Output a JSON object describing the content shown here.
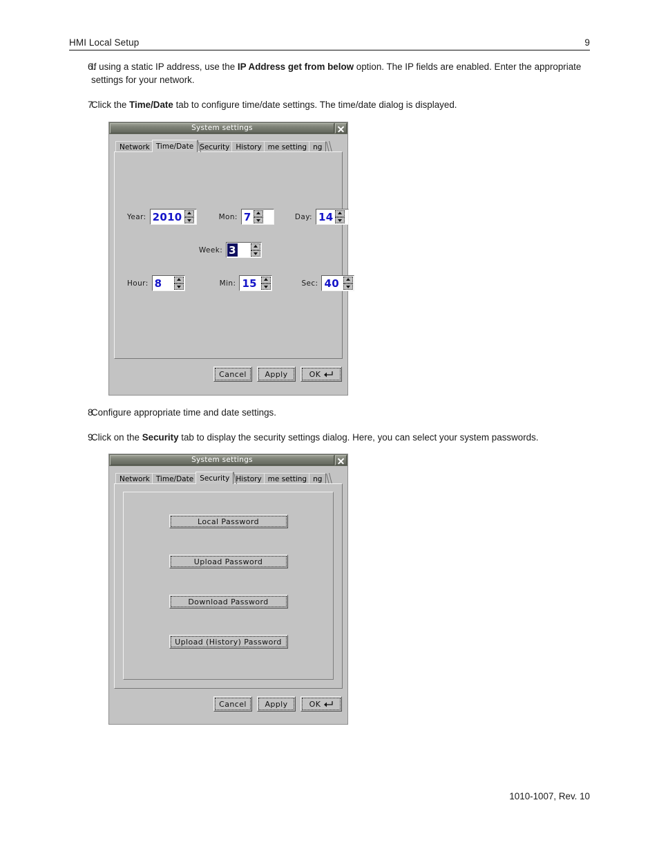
{
  "header": {
    "title": "HMI Local Setup",
    "page_number": "9"
  },
  "steps": [
    {
      "num": "6.",
      "text_before": "If using a static IP address, use the ",
      "bold": "IP Address get from below",
      "text_after": " option. The IP fields are enabled. Enter the appropriate settings for your network."
    },
    {
      "num": "7.",
      "text_before": "Click the ",
      "bold": "Time/Date",
      "text_after": " tab to configure time/date settings. The time/date dialog is displayed."
    },
    {
      "num": "8.",
      "text_before": "Configure appropriate time and date settings.",
      "bold": "",
      "text_after": ""
    },
    {
      "num": "9.",
      "text_before": "Click on the ",
      "bold": "Security",
      "text_after": " tab to display the security settings dialog. Here, you can select your system passwords."
    }
  ],
  "footer": {
    "doc_id": "1010-1007, Rev. 10"
  },
  "dialog_time_date": {
    "title": "System settings",
    "close_icon": "close-x-icon",
    "tabs": [
      {
        "label": "Network",
        "active": false
      },
      {
        "label": "Time/Date",
        "active": true
      },
      {
        "label": "Security",
        "active": false
      },
      {
        "label": "History",
        "active": false
      },
      {
        "label": "me setting",
        "active": false
      },
      {
        "label": "ng",
        "active": false
      }
    ],
    "fields": [
      {
        "label": "Year:",
        "value": "2010",
        "selected": false
      },
      {
        "label": "Mon:",
        "value": "7",
        "selected": false
      },
      {
        "label": "Day:",
        "value": "14",
        "selected": false
      },
      {
        "label": "Week:",
        "value": "3",
        "selected": true
      },
      {
        "label": "Hour:",
        "value": "8",
        "selected": false
      },
      {
        "label": "Min:",
        "value": "15",
        "selected": false
      },
      {
        "label": "Sec:",
        "value": "40",
        "selected": false
      }
    ],
    "buttons": {
      "cancel": "Cancel",
      "apply": "Apply",
      "ok": "OK"
    }
  },
  "dialog_security": {
    "title": "System settings",
    "close_icon": "close-x-icon",
    "tabs": [
      {
        "label": "Network",
        "active": false
      },
      {
        "label": "Time/Date",
        "active": false
      },
      {
        "label": "Security",
        "active": true
      },
      {
        "label": "History",
        "active": false
      },
      {
        "label": "me setting",
        "active": false
      },
      {
        "label": "ng",
        "active": false
      }
    ],
    "password_buttons": [
      "Local Password",
      "Upload Password",
      "Download Password",
      "Upload (History) Password"
    ],
    "buttons": {
      "cancel": "Cancel",
      "apply": "Apply",
      "ok": "OK"
    }
  },
  "colors": {
    "dialog_bg": "#c3c3c3",
    "titlebar": "#7e8277",
    "value_blue": "#1414c8",
    "selection_bg": "#101060"
  }
}
